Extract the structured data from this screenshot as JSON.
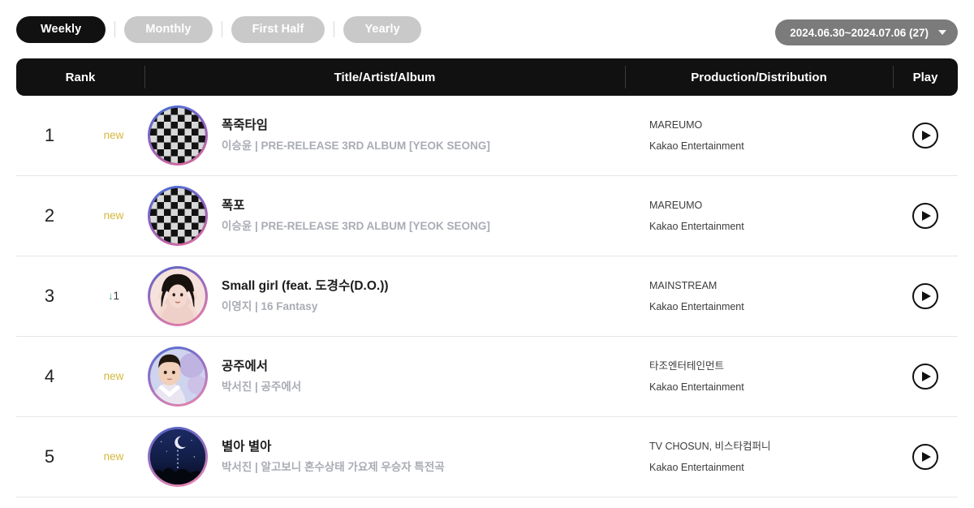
{
  "toolbar": {
    "tabs": [
      {
        "label": "Weekly",
        "active": true
      },
      {
        "label": "Monthly",
        "active": false
      },
      {
        "label": "First Half",
        "active": false
      },
      {
        "label": "Yearly",
        "active": false
      }
    ],
    "date_range": {
      "label": "2024.06.30~2024.07.06 (27)",
      "caret_icon": "chevron-down-icon"
    }
  },
  "table": {
    "headers": {
      "rank": "Rank",
      "title": "Title/Artist/Album",
      "production": "Production/Distribution",
      "play": "Play"
    },
    "rows": [
      {
        "rank": "1",
        "change_type": "new",
        "change_label": "new",
        "title": "폭죽타임",
        "meta": "이승윤 | PRE-RELEASE 3RD ALBUM [YEOK SEONG]",
        "production": "MAREUMO",
        "distribution": "Kakao Entertainment",
        "art": "checkerboard",
        "play_icon": "play-icon"
      },
      {
        "rank": "2",
        "change_type": "new",
        "change_label": "new",
        "title": "폭포",
        "meta": "이승윤 | PRE-RELEASE 3RD ALBUM [YEOK SEONG]",
        "production": "MAREUMO",
        "distribution": "Kakao Entertainment",
        "art": "checkerboard",
        "play_icon": "play-icon"
      },
      {
        "rank": "3",
        "change_type": "down",
        "change_label": "1",
        "change_arrow": "↓",
        "title": "Small girl (feat. 도경수(D.O.))",
        "meta": "이영지 | 16 Fantasy",
        "production": "MAINSTREAM",
        "distribution": "Kakao Entertainment",
        "art": "portrait-female",
        "play_icon": "play-icon"
      },
      {
        "rank": "4",
        "change_type": "new",
        "change_label": "new",
        "title": "공주에서",
        "meta": "박서진 | 공주에서",
        "production": "타조엔터테인먼트",
        "distribution": "Kakao Entertainment",
        "art": "portrait-male",
        "play_icon": "play-icon"
      },
      {
        "rank": "5",
        "change_type": "new",
        "change_label": "new",
        "title": "별아 별아",
        "meta": "박서진 | 알고보니 혼수상태 가요제 우승자 특전곡",
        "production": "TV CHOSUN, 비스타컴퍼니",
        "distribution": "Kakao Entertainment",
        "art": "night-sky",
        "play_icon": "play-icon"
      }
    ]
  },
  "colors": {
    "active_tab_bg": "#111111",
    "inactive_tab_bg": "#c9c9c9",
    "date_bg": "#7b7b7b",
    "header_bg": "#111111",
    "new_badge": "#d4b83c",
    "down_arrow": "#3aa37a",
    "meta_text": "#a9acb4"
  }
}
